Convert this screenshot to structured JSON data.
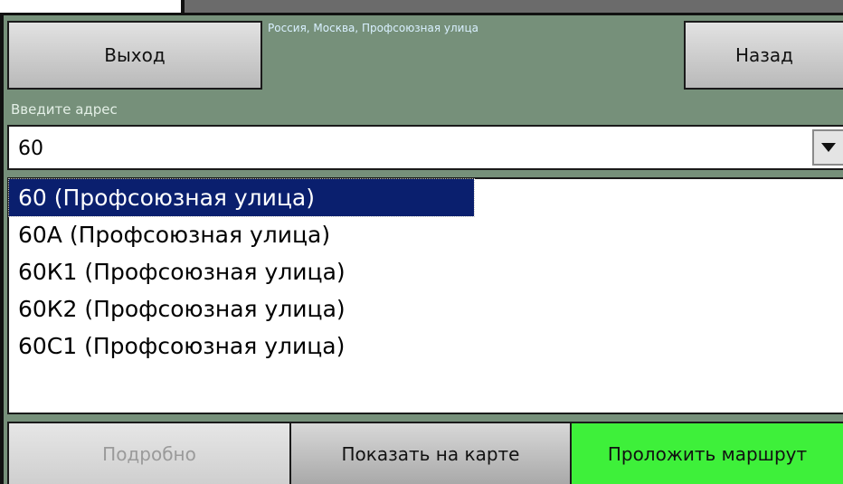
{
  "header": {
    "exit_label": "Выход",
    "back_label": "Назад",
    "location": "Россия, Москва, Профсоюзная улица"
  },
  "address": {
    "label": "Введите адрес",
    "value": "60"
  },
  "results": [
    "60 (Профсоюзная улица)",
    "60А (Профсоюзная улица)",
    "60К1 (Профсоюзная улица)",
    "60К2 (Профсоюзная улица)",
    "60С1 (Профсоюзная улица)"
  ],
  "selected_index": 0,
  "footer": {
    "details_label": "Подробно",
    "show_map_label": "Показать на карте",
    "route_label": "Проложить маршрут"
  },
  "colors": {
    "panel": "#76907a",
    "selection": "#0a1f6e",
    "route_button": "#3ef03a"
  }
}
